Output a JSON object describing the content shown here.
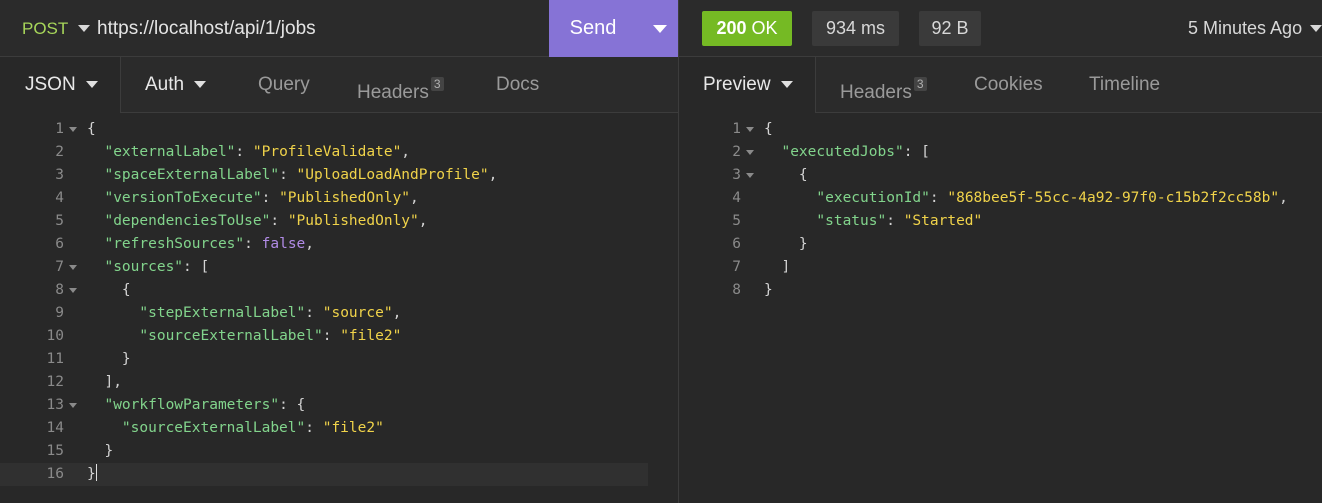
{
  "request": {
    "method": "POST",
    "url": "https://localhost/api/1/jobs",
    "send_label": "Send"
  },
  "response": {
    "status_code": "200",
    "status_text": "OK",
    "time": "934 ms",
    "size": "92 B",
    "ago": "5 Minutes Ago"
  },
  "request_tabs": [
    {
      "label": "JSON",
      "badge": ""
    },
    {
      "label": "Auth",
      "badge": ""
    },
    {
      "label": "Query",
      "badge": ""
    },
    {
      "label": "Headers",
      "badge": "3"
    },
    {
      "label": "Docs",
      "badge": ""
    }
  ],
  "response_tabs": [
    {
      "label": "Preview",
      "badge": ""
    },
    {
      "label": "Headers",
      "badge": "3"
    },
    {
      "label": "Cookies",
      "badge": ""
    },
    {
      "label": "Timeline",
      "badge": ""
    }
  ],
  "request_body": [
    {
      "n": "1",
      "fold": true,
      "tokens": [
        [
          "punc",
          "{"
        ]
      ]
    },
    {
      "n": "2",
      "fold": false,
      "tokens": [
        [
          "punc",
          "  "
        ],
        [
          "key",
          "\"externalLabel\""
        ],
        [
          "punc",
          ": "
        ],
        [
          "str",
          "\"ProfileValidate\""
        ],
        [
          "punc",
          ","
        ]
      ]
    },
    {
      "n": "3",
      "fold": false,
      "tokens": [
        [
          "punc",
          "  "
        ],
        [
          "key",
          "\"spaceExternalLabel\""
        ],
        [
          "punc",
          ": "
        ],
        [
          "str",
          "\"UploadLoadAndProfile\""
        ],
        [
          "punc",
          ","
        ]
      ]
    },
    {
      "n": "4",
      "fold": false,
      "tokens": [
        [
          "punc",
          "  "
        ],
        [
          "key",
          "\"versionToExecute\""
        ],
        [
          "punc",
          ": "
        ],
        [
          "str",
          "\"PublishedOnly\""
        ],
        [
          "punc",
          ","
        ]
      ]
    },
    {
      "n": "5",
      "fold": false,
      "tokens": [
        [
          "punc",
          "  "
        ],
        [
          "key",
          "\"dependenciesToUse\""
        ],
        [
          "punc",
          ": "
        ],
        [
          "str",
          "\"PublishedOnly\""
        ],
        [
          "punc",
          ","
        ]
      ]
    },
    {
      "n": "6",
      "fold": false,
      "tokens": [
        [
          "punc",
          "  "
        ],
        [
          "key",
          "\"refreshSources\""
        ],
        [
          "punc",
          ": "
        ],
        [
          "bool",
          "false"
        ],
        [
          "punc",
          ","
        ]
      ]
    },
    {
      "n": "7",
      "fold": true,
      "tokens": [
        [
          "punc",
          "  "
        ],
        [
          "key",
          "\"sources\""
        ],
        [
          "punc",
          ": ["
        ]
      ]
    },
    {
      "n": "8",
      "fold": true,
      "tokens": [
        [
          "punc",
          "    {"
        ]
      ]
    },
    {
      "n": "9",
      "fold": false,
      "tokens": [
        [
          "punc",
          "      "
        ],
        [
          "key",
          "\"stepExternalLabel\""
        ],
        [
          "punc",
          ": "
        ],
        [
          "str",
          "\"source\""
        ],
        [
          "punc",
          ","
        ]
      ]
    },
    {
      "n": "10",
      "fold": false,
      "tokens": [
        [
          "punc",
          "      "
        ],
        [
          "key",
          "\"sourceExternalLabel\""
        ],
        [
          "punc",
          ": "
        ],
        [
          "str",
          "\"file2\""
        ]
      ]
    },
    {
      "n": "11",
      "fold": false,
      "tokens": [
        [
          "punc",
          "    }"
        ]
      ]
    },
    {
      "n": "12",
      "fold": false,
      "tokens": [
        [
          "punc",
          "  ],"
        ]
      ]
    },
    {
      "n": "13",
      "fold": true,
      "tokens": [
        [
          "punc",
          "  "
        ],
        [
          "key",
          "\"workflowParameters\""
        ],
        [
          "punc",
          ": {"
        ]
      ]
    },
    {
      "n": "14",
      "fold": false,
      "tokens": [
        [
          "punc",
          "    "
        ],
        [
          "key",
          "\"sourceExternalLabel\""
        ],
        [
          "punc",
          ": "
        ],
        [
          "str",
          "\"file2\""
        ]
      ]
    },
    {
      "n": "15",
      "fold": false,
      "tokens": [
        [
          "punc",
          "  }"
        ]
      ]
    },
    {
      "n": "16",
      "fold": false,
      "current": true,
      "tokens": [
        [
          "punc",
          "}"
        ]
      ]
    }
  ],
  "response_body": [
    {
      "n": "1",
      "fold": true,
      "tokens": [
        [
          "punc",
          "{"
        ]
      ]
    },
    {
      "n": "2",
      "fold": true,
      "tokens": [
        [
          "punc",
          "  "
        ],
        [
          "key",
          "\"executedJobs\""
        ],
        [
          "punc",
          ": ["
        ]
      ]
    },
    {
      "n": "3",
      "fold": true,
      "tokens": [
        [
          "punc",
          "    {"
        ]
      ]
    },
    {
      "n": "4",
      "fold": false,
      "tokens": [
        [
          "punc",
          "      "
        ],
        [
          "key",
          "\"executionId\""
        ],
        [
          "punc",
          ": "
        ],
        [
          "str",
          "\"868bee5f-55cc-4a92-97f0-c15b2f2cc58b\""
        ],
        [
          "punc",
          ","
        ]
      ]
    },
    {
      "n": "5",
      "fold": false,
      "tokens": [
        [
          "punc",
          "      "
        ],
        [
          "key",
          "\"status\""
        ],
        [
          "punc",
          ": "
        ],
        [
          "str",
          "\"Started\""
        ]
      ]
    },
    {
      "n": "6",
      "fold": false,
      "tokens": [
        [
          "punc",
          "    }"
        ]
      ]
    },
    {
      "n": "7",
      "fold": false,
      "tokens": [
        [
          "punc",
          "  ]"
        ]
      ]
    },
    {
      "n": "8",
      "fold": false,
      "tokens": [
        [
          "punc",
          "}"
        ]
      ]
    }
  ]
}
